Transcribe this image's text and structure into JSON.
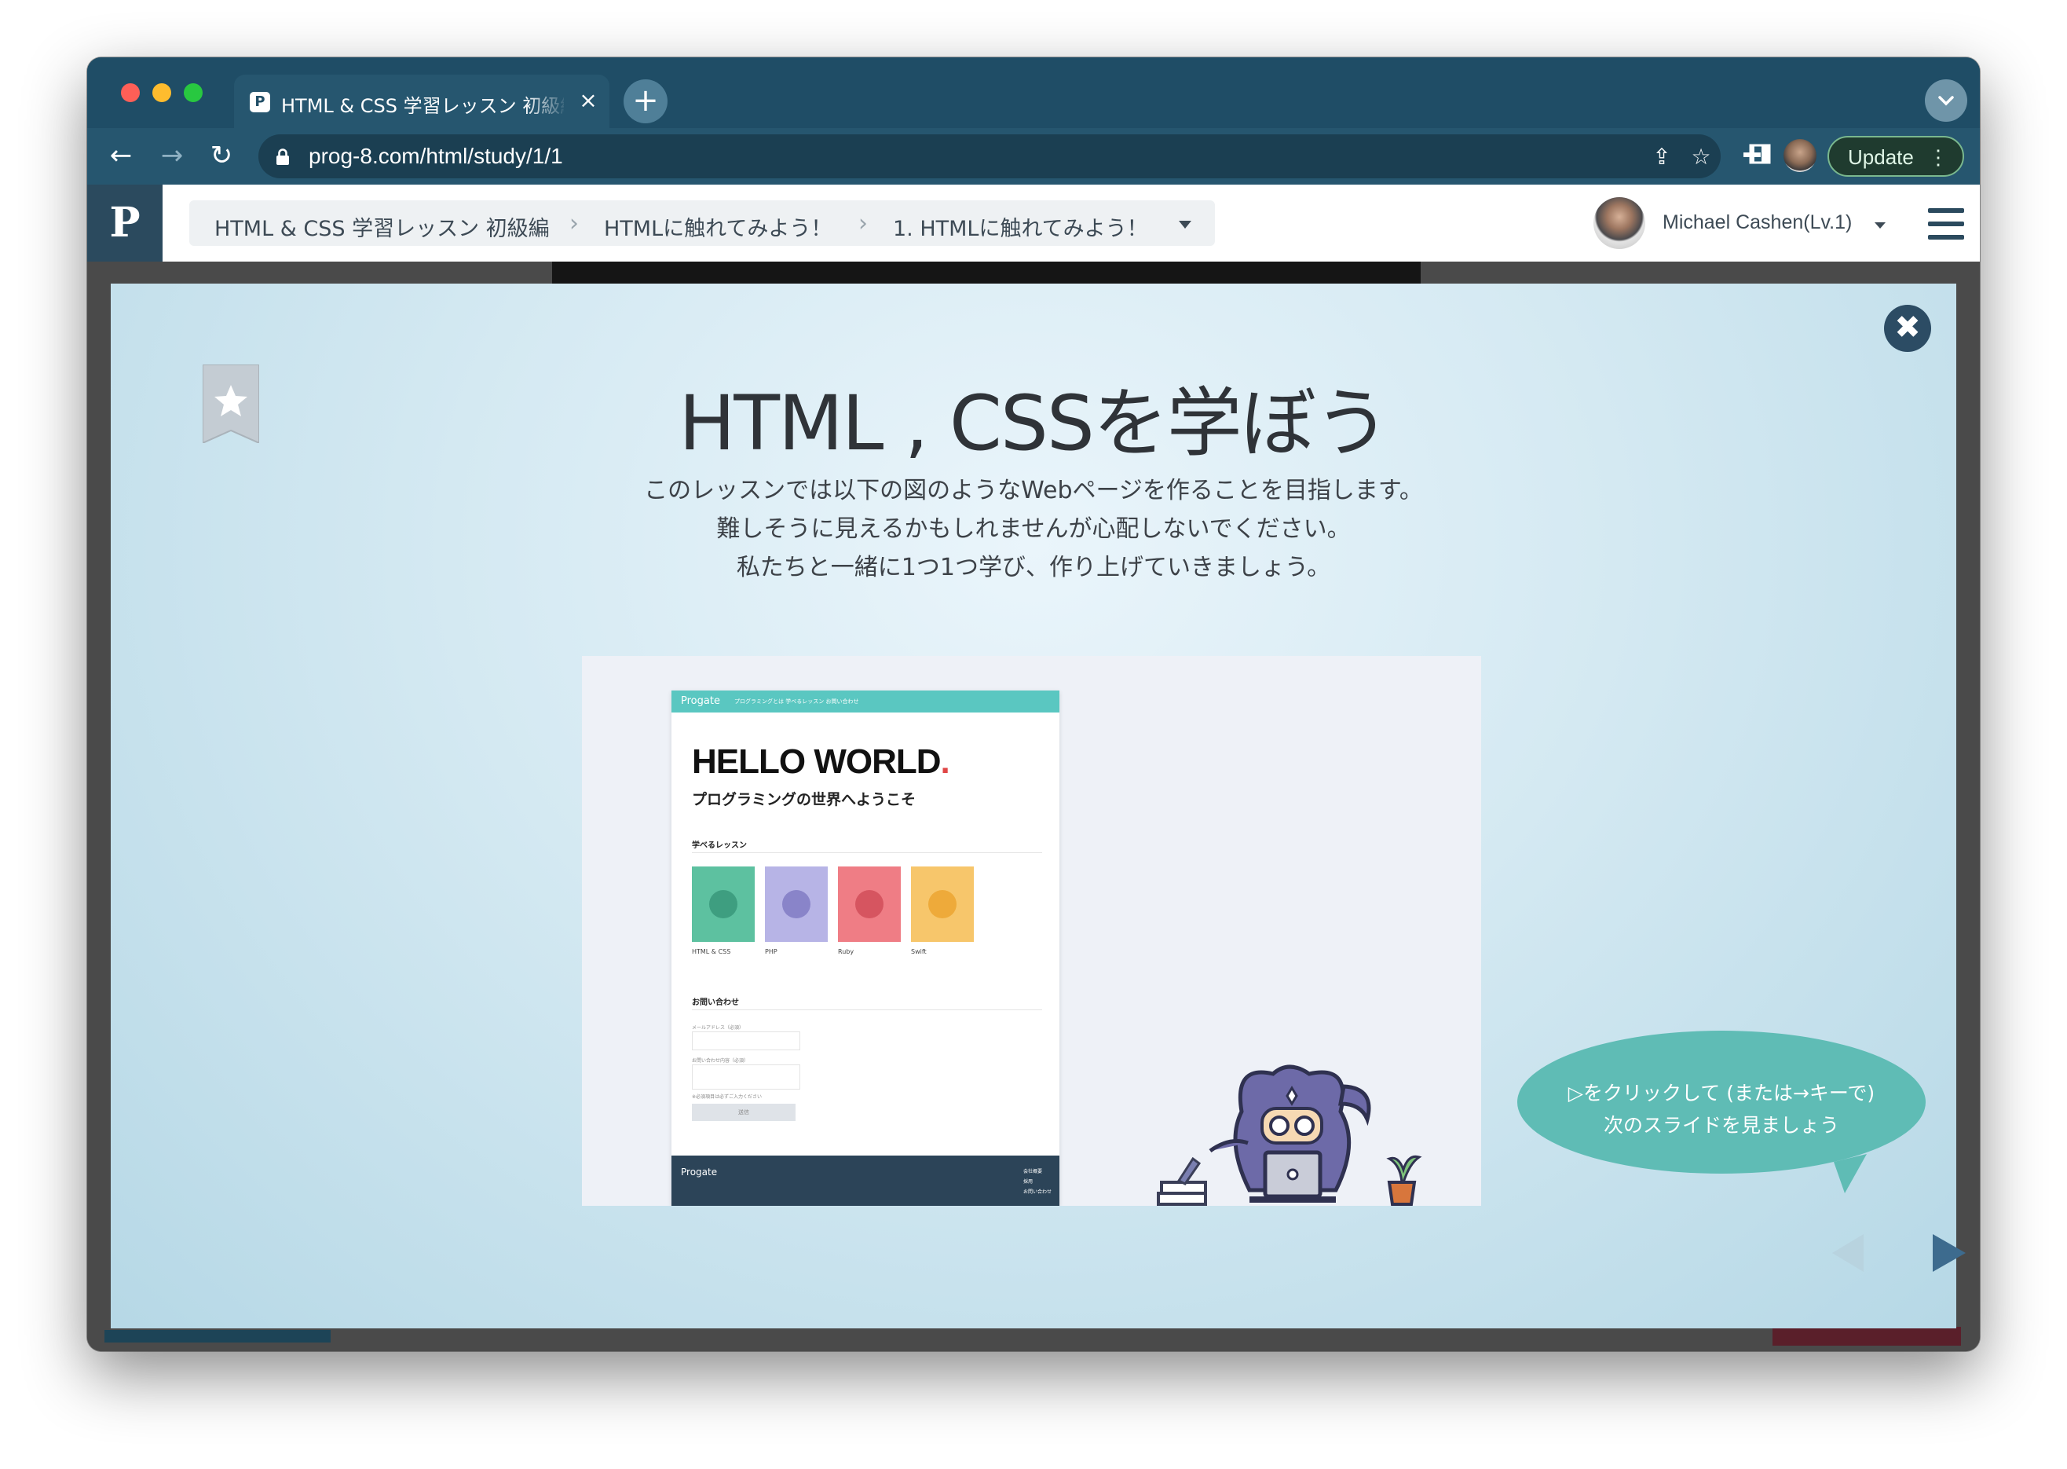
{
  "browser": {
    "tab_title": "HTML & CSS 学習レッスン 初級編",
    "tab_close": "×",
    "new_tab": "+",
    "url": "prog-8.com/html/study/1/1",
    "update_label": "Update"
  },
  "header": {
    "logo": "P",
    "breadcrumbs": [
      {
        "label": "HTML & CSS 学習レッスン 初級編"
      },
      {
        "label": "HTMLに触れてみよう！"
      },
      {
        "label": "1. HTMLに触れてみよう！"
      }
    ],
    "user_name": "Michael Cashen(Lv.1)"
  },
  "slide": {
    "title": "HTML , CSSを学ぼう",
    "description": [
      "このレッスンでは以下の図のようなWebページを作ることを目指します。",
      "難しそうに見えるかもしれませんが心配しないでください。",
      "私たちと一緒に1つ1つ学び、作り上げていきましょう。"
    ],
    "close_icon": "✖",
    "hint": [
      "▷をクリックして (または→キーで)",
      "次のスライドを見ましょう"
    ]
  },
  "mockup": {
    "brand": "Progate",
    "nav": "プログラミングとは     学べるレッスン     お問い合わせ",
    "hello": "HELLO WORLD",
    "hello_dot": ".",
    "subtitle": "プログラミングの世界へようこそ",
    "lessons_heading": "学べるレッスン",
    "lessons": [
      {
        "label": "HTML & CSS",
        "color": "#5dc1a0",
        "circle": "#3e9e80"
      },
      {
        "label": "PHP",
        "color": "#b7b4e6",
        "circle": "#8984c9"
      },
      {
        "label": "Ruby",
        "color": "#ef7d85",
        "circle": "#d65560"
      },
      {
        "label": "Swift",
        "color": "#f7c66b",
        "circle": "#eeaa3a"
      }
    ],
    "contact_heading": "お問い合わせ",
    "field_email": "メールアドレス（必須）",
    "field_message": "お問い合わせ内容（必須）",
    "field_note": "※必須項目は必ずご入力ください",
    "submit": "送信",
    "footer_brand": "Progate",
    "footer_links": [
      "会社概要",
      "採用",
      "お問い合わせ"
    ]
  },
  "colors": {
    "chrome": "#26566f",
    "header_dark": "#2b4a5e",
    "bubble": "#5fbcb5",
    "next_arrow": "#3d6b8e"
  }
}
